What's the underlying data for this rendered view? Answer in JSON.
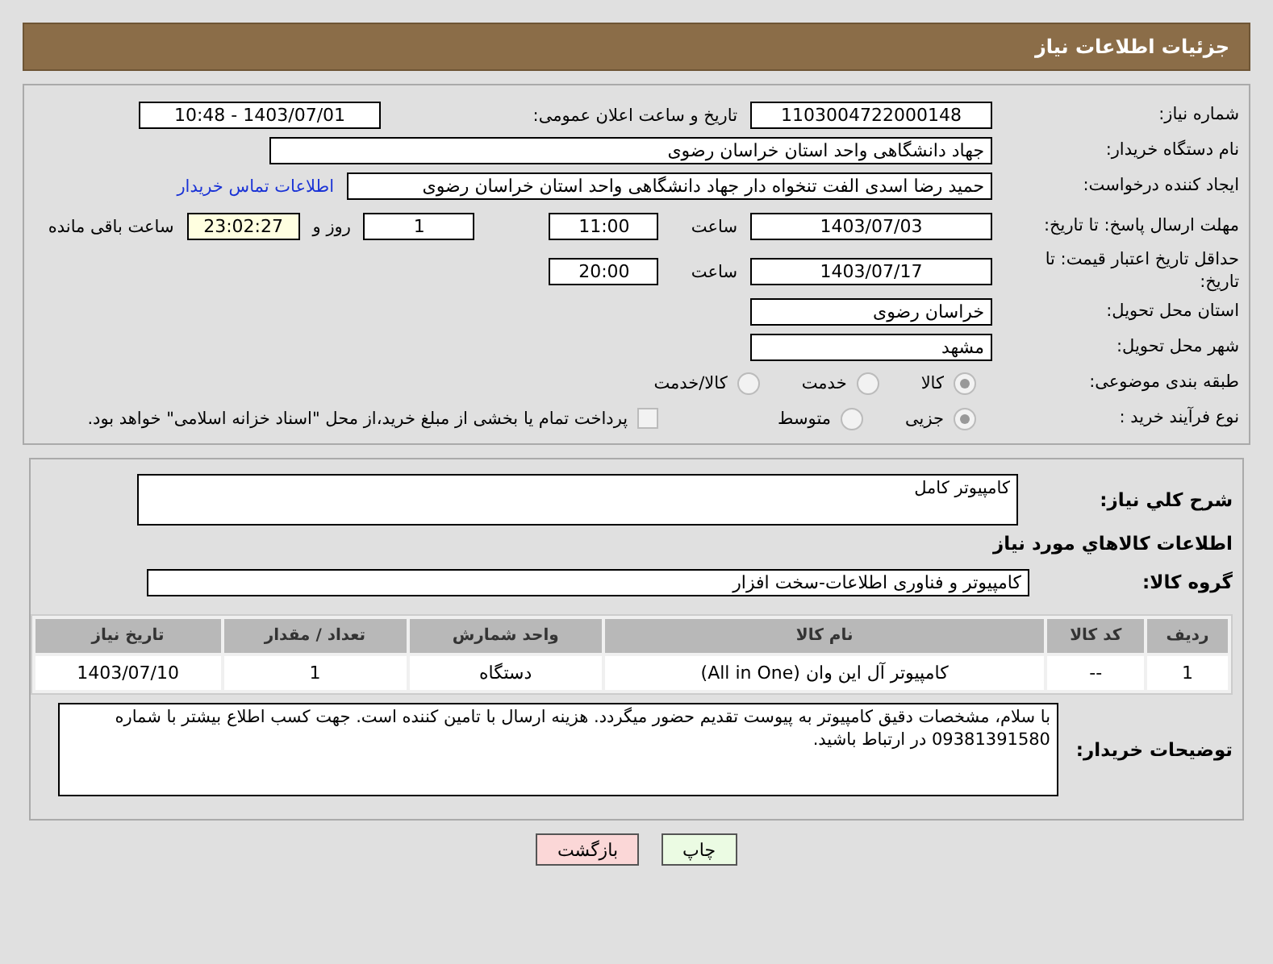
{
  "header": {
    "title": "جزئیات اطلاعات نیاز"
  },
  "details": {
    "need_number": {
      "label": "شماره نیاز:",
      "value": "1103004722000148"
    },
    "announce": {
      "label": "تاریخ و ساعت اعلان عمومی:",
      "value": "1403/07/01 - 10:48"
    },
    "buyer": {
      "label": "نام دستگاه خریدار:",
      "value": "جهاد دانشگاهی واحد استان خراسان رضوی"
    },
    "creator": {
      "label": "ایجاد کننده درخواست:",
      "value": "حمید رضا اسدی الفت تنخواه دار جهاد دانشگاهی واحد استان خراسان رضوی",
      "link": "اطلاعات تماس خریدار"
    },
    "deadline": {
      "label": "مهلت ارسال پاسخ: تا تاریخ:",
      "date": "1403/07/03",
      "time_label": "ساعت",
      "time": "11:00",
      "days": "1",
      "days_label": "روز و",
      "remaining": "23:02:27",
      "remaining_label": "ساعت باقی مانده"
    },
    "validity": {
      "label": "حداقل تاریخ اعتبار قیمت: تا تاریخ:",
      "date": "1403/07/17",
      "time_label": "ساعت",
      "time": "20:00"
    },
    "province": {
      "label": "استان محل تحویل:",
      "value": "خراسان رضوی"
    },
    "city": {
      "label": "شهر محل تحویل:",
      "value": "مشهد"
    },
    "category": {
      "label": "طبقه بندی موضوعی:",
      "options": [
        {
          "label": "کالا",
          "selected": true
        },
        {
          "label": "خدمت",
          "selected": false
        },
        {
          "label": "کالا/خدمت",
          "selected": false
        }
      ]
    },
    "process": {
      "label": "نوع فرآیند خرید :",
      "options": [
        {
          "label": "جزیی",
          "selected": true
        },
        {
          "label": "متوسط",
          "selected": false
        }
      ],
      "payment": {
        "label": "پرداخت تمام یا بخشی از مبلغ خرید،از محل \"اسناد خزانه اسلامی\" خواهد بود.",
        "checked": false
      }
    }
  },
  "goods": {
    "summary": {
      "label": "شرح کلي نیاز:",
      "value": "کامپیوتر کامل"
    },
    "heading": "اطلاعات کالاهاي مورد نياز",
    "group": {
      "label": "گروه کالا:",
      "value": "کامپیوتر و فناوری اطلاعات-سخت افزار"
    },
    "table": {
      "columns": [
        "ردیف",
        "کد کالا",
        "نام کالا",
        "واحد شمارش",
        "تعداد / مقدار",
        "تاریخ نیاز"
      ],
      "rows": [
        [
          "1",
          "--",
          "کامپیوتر آل این وان (All in One)",
          "دستگاه",
          "1",
          "1403/07/10"
        ]
      ]
    },
    "notes": {
      "label": "توضیحات خریدار:",
      "value": "با سلام، مشخصات دقیق کامپیوتر به پیوست تقدیم حضور میگردد. هزینه ارسال با تامین کننده است. جهت کسب اطلاع بیشتر با شماره 09381391580 در ارتباط باشید."
    }
  },
  "buttons": [
    {
      "label": "چاپ",
      "kind": "print"
    },
    {
      "label": "بازگشت",
      "kind": "back"
    }
  ]
}
